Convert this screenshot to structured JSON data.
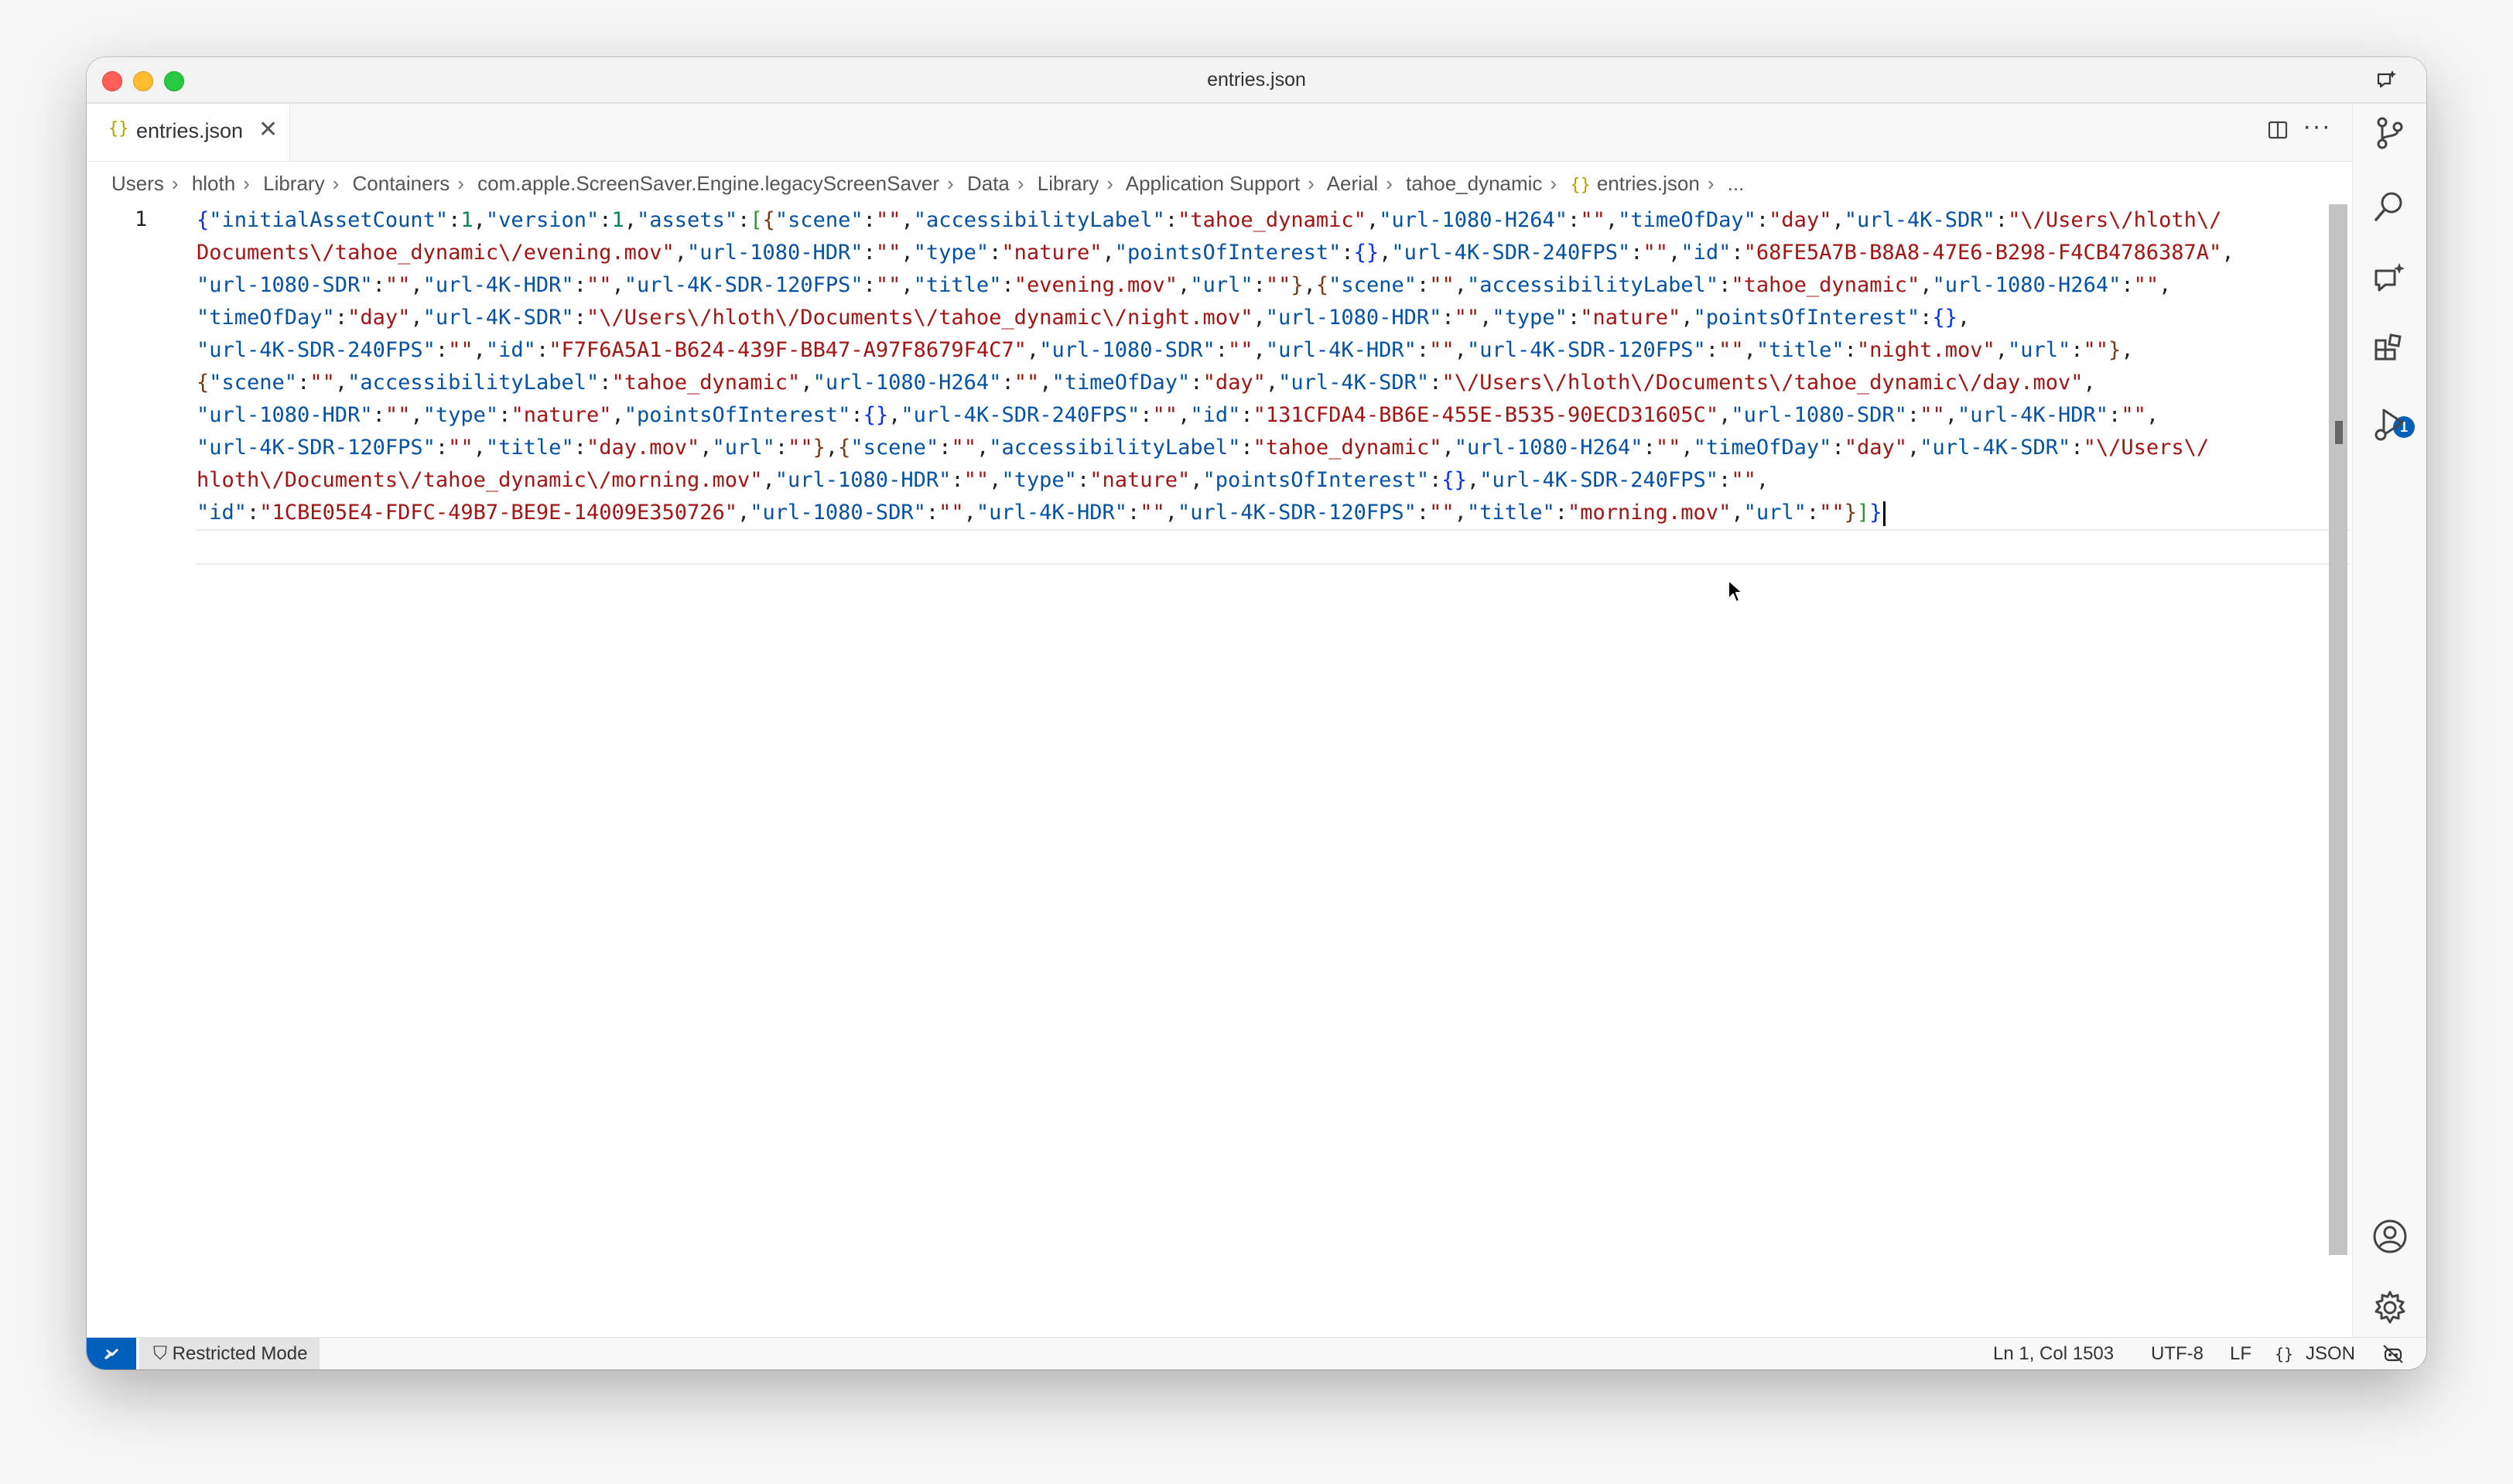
{
  "window": {
    "title": "entries.json"
  },
  "tab": {
    "icon": "{}",
    "label": "entries.json",
    "close": "✕"
  },
  "toolbar": {
    "more": "···"
  },
  "breadcrumb": [
    "Users",
    "hloth",
    "Library",
    "Containers",
    "com.apple.ScreenSaver.Engine.legacyScreenSaver",
    "Data",
    "Library",
    "Application Support",
    "Aerial",
    "tahoe_dynamic"
  ],
  "breadcrumb_file": "entries.json",
  "breadcrumb_more": "...",
  "editor": {
    "line_number": "1",
    "code_lines": [
      "{\"initialAssetCount\":1,\"version\":1,\"assets\":[{\"scene\":\"\",\"accessibilityLabel\":\"tahoe_dynamic\",\"url-1080-H264\":\"\",\"timeOfDay\":\"day\",\"url-4K-SDR\":\"\\/Users\\/hloth\\/",
      "Documents\\/tahoe_dynamic\\/evening.mov\",\"url-1080-HDR\":\"\",\"type\":\"nature\",\"pointsOfInterest\":{},\"url-4K-SDR-240FPS\":\"\",\"id\":\"68FE5A7B-B8A8-47E6-B298-F4CB4786387A\",",
      "\"url-1080-SDR\":\"\",\"url-4K-HDR\":\"\",\"url-4K-SDR-120FPS\":\"\",\"title\":\"evening.mov\",\"url\":\"\"},{\"scene\":\"\",\"accessibilityLabel\":\"tahoe_dynamic\",\"url-1080-H264\":\"\",",
      "\"timeOfDay\":\"day\",\"url-4K-SDR\":\"\\/Users\\/hloth\\/Documents\\/tahoe_dynamic\\/night.mov\",\"url-1080-HDR\":\"\",\"type\":\"nature\",\"pointsOfInterest\":{},",
      "\"url-4K-SDR-240FPS\":\"\",\"id\":\"F7F6A5A1-B624-439F-BB47-A97F8679F4C7\",\"url-1080-SDR\":\"\",\"url-4K-HDR\":\"\",\"url-4K-SDR-120FPS\":\"\",\"title\":\"night.mov\",\"url\":\"\"},",
      "{\"scene\":\"\",\"accessibilityLabel\":\"tahoe_dynamic\",\"url-1080-H264\":\"\",\"timeOfDay\":\"day\",\"url-4K-SDR\":\"\\/Users\\/hloth\\/Documents\\/tahoe_dynamic\\/day.mov\",",
      "\"url-1080-HDR\":\"\",\"type\":\"nature\",\"pointsOfInterest\":{},\"url-4K-SDR-240FPS\":\"\",\"id\":\"131CFDA4-BB6E-455E-B535-90ECD31605C\",\"url-1080-SDR\":\"\",\"url-4K-HDR\":\"\",",
      "\"url-4K-SDR-120FPS\":\"\",\"title\":\"day.mov\",\"url\":\"\"},{\"scene\":\"\",\"accessibilityLabel\":\"tahoe_dynamic\",\"url-1080-H264\":\"\",\"timeOfDay\":\"day\",\"url-4K-SDR\":\"\\/Users\\/",
      "hloth\\/Documents\\/tahoe_dynamic\\/morning.mov\",\"url-1080-HDR\":\"\",\"type\":\"nature\",\"pointsOfInterest\":{},\"url-4K-SDR-240FPS\":\"\",",
      "\"id\":\"1CBE05E4-FDFC-49B7-BE9E-14009E350726\",\"url-1080-SDR\":\"\",\"url-4K-HDR\":\"\",\"url-4K-SDR-120FPS\":\"\",\"title\":\"morning.mov\",\"url\":\"\"}]}"
    ]
  },
  "activitybar": {
    "icons": [
      "source-control-icon",
      "search-icon",
      "copilot-chat-icon",
      "extensions-icon",
      "run-debug-icon",
      "accounts-icon",
      "manage-gear-icon"
    ],
    "extensions_badge": "1"
  },
  "statusbar": {
    "restricted_mode": "Restricted Mode",
    "cursor_position": "Ln 1, Col 1503",
    "encoding": "UTF-8",
    "eol": "LF",
    "language_icon": "{}",
    "language": "JSON"
  },
  "colors": {
    "accent": "#005fb8",
    "json_key": "#0451a5",
    "json_string": "#a31515",
    "json_number": "#098658"
  }
}
